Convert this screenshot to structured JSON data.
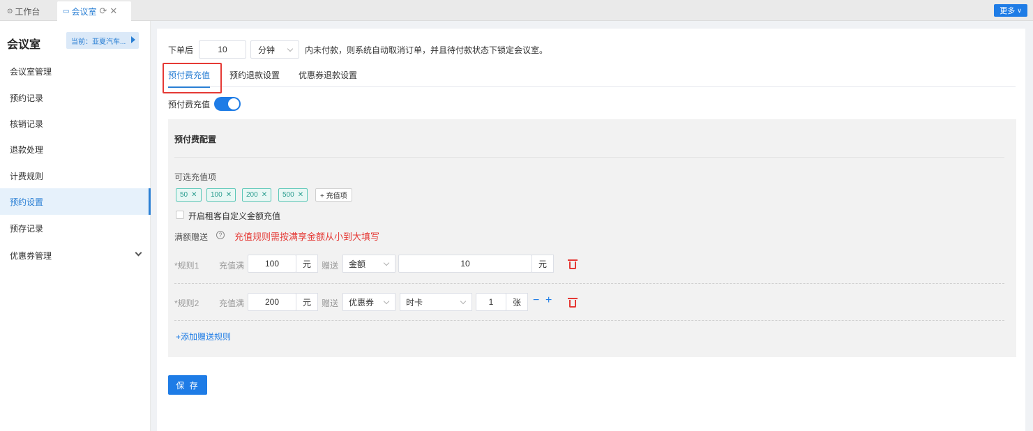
{
  "topbar": {
    "tabs": [
      {
        "icon": "dashboard-icon",
        "label": "工作台"
      },
      {
        "icon": "monitor-icon",
        "label": "会议室"
      }
    ],
    "more_label": "更多"
  },
  "sidebar": {
    "title": "会议室",
    "current": "当前：亚夏汽车...",
    "items": [
      {
        "label": "会议室管理"
      },
      {
        "label": "预约记录"
      },
      {
        "label": "核销记录"
      },
      {
        "label": "退款处理"
      },
      {
        "label": "计费规则"
      },
      {
        "label": "预约设置",
        "active": true
      },
      {
        "label": "预存记录"
      },
      {
        "label": "优惠券管理",
        "has_submenu": true
      }
    ]
  },
  "order": {
    "prefix": "下单后",
    "minutes": "10",
    "unit": "分钟",
    "suffix": "内未付款，则系统自动取消订单，并且待付款状态下锁定会议室。"
  },
  "tabs": [
    {
      "label": "预付费充值",
      "active": true
    },
    {
      "label": "预约退款设置"
    },
    {
      "label": "优惠券退款设置"
    }
  ],
  "prepay_toggle": {
    "label": "预付费充值",
    "on": true
  },
  "config": {
    "title": "预付费配置",
    "options_label": "可选充值项",
    "options": [
      "50",
      "100",
      "200",
      "500"
    ],
    "add_option_label": "+ 充值项",
    "custom_amount_label": "开启租客自定义金额充值",
    "gift_label": "满额赠送",
    "warning": "充值规则需按满享金额从小到大填写",
    "rules": [
      {
        "label": "*规则1",
        "threshold_label": "充值满",
        "threshold": "100",
        "unit": "元",
        "gift_label": "赠送",
        "gift_type": "金额",
        "gift_value": "10",
        "gift_unit": "元"
      },
      {
        "label": "*规则2",
        "threshold_label": "充值满",
        "threshold": "200",
        "unit": "元",
        "gift_label": "赠送",
        "gift_type": "优惠券",
        "coupon_type": "时卡",
        "gift_value": "1",
        "gift_unit": "张"
      }
    ],
    "add_rule_label": "+添加赠送规则"
  },
  "save_label": "保 存",
  "colors": {
    "accent": "#1e7ce6",
    "warning": "#e53935",
    "tag": "#2a9d8f"
  }
}
